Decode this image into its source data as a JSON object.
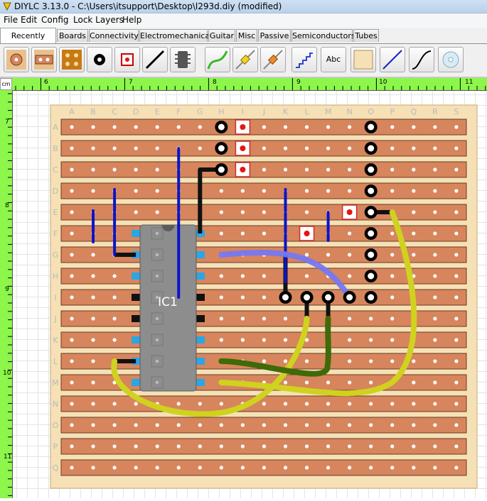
{
  "window": {
    "title": "DIYLC 3.13.0 - C:\\Users\\itsupport\\Desktop\\l293d.diy  (modified)"
  },
  "menu": [
    "File",
    "Edit",
    "Config",
    "Lock Layers",
    "Help"
  ],
  "tabs": [
    {
      "label": "Recently Used",
      "active": true
    },
    {
      "label": "Boards"
    },
    {
      "label": "Connectivity"
    },
    {
      "label": "Electromechanical"
    },
    {
      "label": "Guitar"
    },
    {
      "label": "Misc"
    },
    {
      "label": "Passive"
    },
    {
      "label": "Semiconductors"
    },
    {
      "label": "Tubes"
    }
  ],
  "toolbar": {
    "tools": [
      {
        "name": "round-pad-icon"
      },
      {
        "name": "dual-pad-icon"
      },
      {
        "name": "pad-grid-icon"
      },
      {
        "name": "eyelet-icon"
      },
      {
        "name": "square-pad-icon"
      },
      {
        "name": "jumper-wire-icon"
      },
      {
        "name": "dip-ic-icon"
      },
      {
        "name": "hookup-wire-icon"
      },
      {
        "name": "resistor-yellow-icon"
      },
      {
        "name": "resistor-orange-icon"
      },
      {
        "name": "staircase-trace-icon"
      },
      {
        "name": "text-label-icon",
        "text": "Abc"
      },
      {
        "name": "rectangle-shape-icon"
      },
      {
        "name": "line-icon"
      },
      {
        "name": "curve-icon"
      },
      {
        "name": "disc-icon"
      }
    ]
  },
  "ruler": {
    "unit": "cm",
    "h_labels": [
      "6",
      "7",
      "8",
      "9",
      "10",
      "11"
    ],
    "v_labels": [
      "7",
      "8",
      "9",
      "10",
      "11"
    ]
  },
  "board": {
    "columns": [
      "A",
      "B",
      "C",
      "D",
      "E",
      "F",
      "G",
      "H",
      "I",
      "J",
      "K",
      "L",
      "M",
      "N",
      "O",
      "P",
      "Q",
      "R",
      "S"
    ],
    "rows": [
      "A",
      "B",
      "C",
      "D",
      "E",
      "F",
      "G",
      "H",
      "I",
      "J",
      "K",
      "L",
      "M",
      "N",
      "O",
      "P",
      "Q"
    ],
    "ic_label": "IC1",
    "colors": {
      "board": "#f5e1b5",
      "strip": "#d7855d",
      "strip_edge": "#6a3a22",
      "jumper_blue": "#0b14c8",
      "wire_lavender": "#7677f0",
      "wire_yellow": "#cfd21e",
      "wire_dark_green": "#3f6a08",
      "ic_body": "#8d8d8d",
      "ic_pin": "#2aa6e6",
      "pad_red": "#e21616"
    }
  }
}
